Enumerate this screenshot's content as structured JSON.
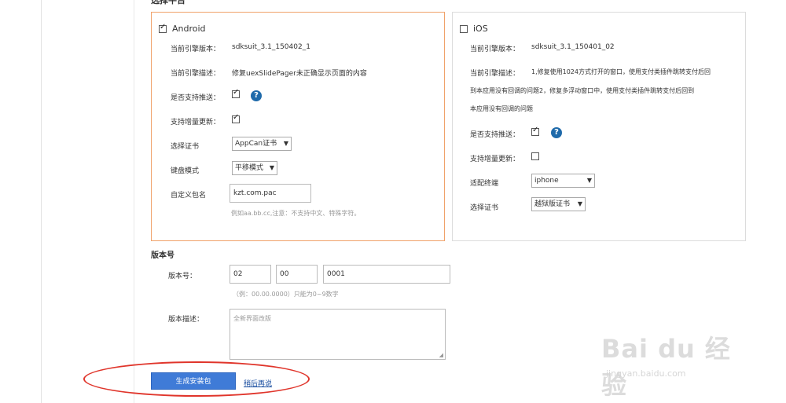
{
  "section": {
    "title_partial": "选择平台"
  },
  "android": {
    "platform_label": "Android",
    "checked": true,
    "engine_version_label": "当前引擎版本：",
    "engine_version": "sdksuit_3.1_150402_1",
    "engine_desc_label": "当前引擎描述：",
    "engine_desc": "修复uexSlidePager未正确显示页面的内容",
    "push_label": "是否支持推送：",
    "push_checked": true,
    "incremental_label": "支持增量更新：",
    "incremental_checked": true,
    "cert_label": "选择证书",
    "cert_value": "AppCan证书",
    "keyboard_label": "键盘模式",
    "keyboard_value": "平移模式",
    "package_label": "自定义包名",
    "package_value": "kzt.com.pac",
    "package_hint": "例如aa.bb.cc,注意：不支持中文、特殊字符。"
  },
  "ios": {
    "platform_label": "iOS",
    "checked": false,
    "engine_version_label": "当前引擎版本：",
    "engine_version": "sdksuit_3.1_150401_02",
    "engine_desc_label": "当前引擎描述：",
    "engine_desc_lines": [
      "1,修复使用1024方式打开的窗口，使用支付类插件跳转支付后回",
      "到本应用没有回调的问题2，修复多浮动窗口中，使用支付类插件跳转支付后回到",
      "本应用没有回调的问题"
    ],
    "push_label": "是否支持推送：",
    "push_checked": true,
    "incremental_label": "支持增量更新：",
    "incremental_checked": false,
    "device_label": "适配终端",
    "device_value": "iphone",
    "cert_label": "选择证书",
    "cert_value": "越狱版证书"
  },
  "version": {
    "section_title": "版本号",
    "label": "版本号：",
    "major": "02",
    "minor": "00",
    "patch": "0001",
    "hint": "（例：00.00.0000）只能为0~9数字",
    "desc_label": "版本描述：",
    "desc_placeholder": "全新界面改版"
  },
  "actions": {
    "generate_label": "生成安装包",
    "later_label": "稍后再说"
  },
  "watermark": {
    "text": "Bai du 经验",
    "url": "jingyan.baidu.com"
  },
  "icons": {
    "help": "?",
    "caret": "▼",
    "resize": "◢"
  }
}
